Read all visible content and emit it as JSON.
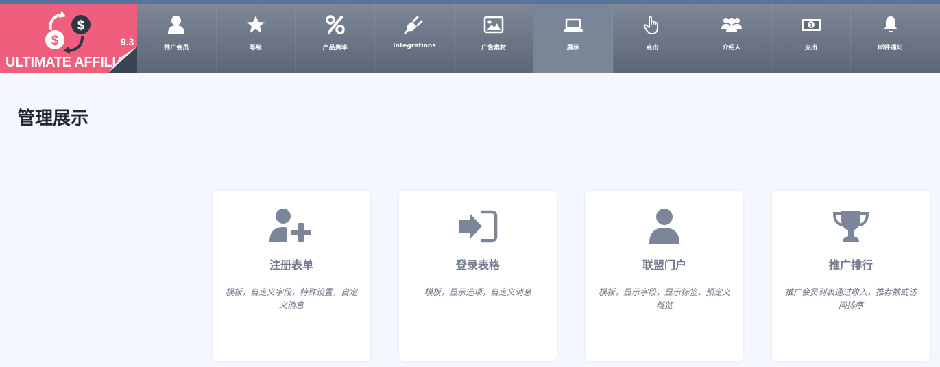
{
  "brand": {
    "name": "ULTIMATE AFFILIATE",
    "version": "9.3",
    "logo_icon": "money-exchange-icon",
    "colors": {
      "logo_bg": "#ef5f7d",
      "header_top": "#7d8797",
      "header_bottom": "#5c6676",
      "nav_active": "#7a8698",
      "top_strip": "#5a7399"
    }
  },
  "nav": {
    "items": [
      {
        "label": "推广会员",
        "icon": "user-icon"
      },
      {
        "label": "等级",
        "icon": "star-icon"
      },
      {
        "label": "产品费率",
        "icon": "percent-icon"
      },
      {
        "label": "Integrations",
        "icon": "plug-icon"
      },
      {
        "label": "广告素材",
        "icon": "image-icon"
      },
      {
        "label": "展示",
        "icon": "laptop-icon",
        "active": true
      },
      {
        "label": "点击",
        "icon": "pointer-hand-icon"
      },
      {
        "label": "介绍人",
        "icon": "users-group-icon"
      },
      {
        "label": "支出",
        "icon": "money-bill-icon"
      },
      {
        "label": "邮件通知",
        "icon": "bell-icon"
      }
    ]
  },
  "page": {
    "title": "管理展示"
  },
  "cards": [
    {
      "title": "注册表单",
      "description": "模板，自定义字段，特殊设置，自定义消息",
      "icon": "user-plus-icon"
    },
    {
      "title": "登录表格",
      "description": "模板，显示选项，自定义消息",
      "icon": "sign-in-icon"
    },
    {
      "title": "联盟门户",
      "description": "模板，显示字段，显示标签，预定义概览",
      "icon": "user-icon"
    },
    {
      "title": "推广排行",
      "description": "推广会员列表通过收入，推荐数或访问排序",
      "icon": "trophy-icon"
    }
  ]
}
